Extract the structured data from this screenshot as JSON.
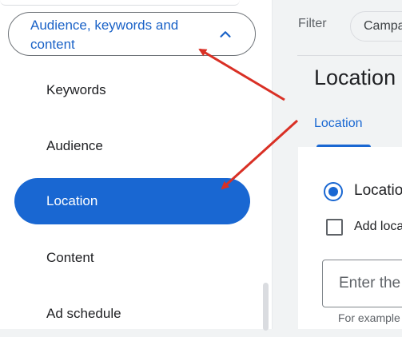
{
  "sidebar": {
    "section": {
      "title": "Audience, keywords and content",
      "expand_icon": "chevron-up-icon"
    },
    "items": [
      {
        "label": "Keywords",
        "selected": false
      },
      {
        "label": "Audience",
        "selected": false
      },
      {
        "label": "Location",
        "selected": true
      },
      {
        "label": "Content",
        "selected": false
      },
      {
        "label": "Ad schedule",
        "selected": false
      }
    ]
  },
  "filter": {
    "label": "Filter",
    "chip_text": "Campa"
  },
  "main": {
    "title": "Location",
    "tab": "Location",
    "radio_label": "Locatio",
    "checkbox_label": "Add loca",
    "input_placeholder": "Enter the",
    "helper_text": "For example"
  },
  "colors": {
    "accent": "#1967d2",
    "annotation_arrow": "#d93025"
  }
}
